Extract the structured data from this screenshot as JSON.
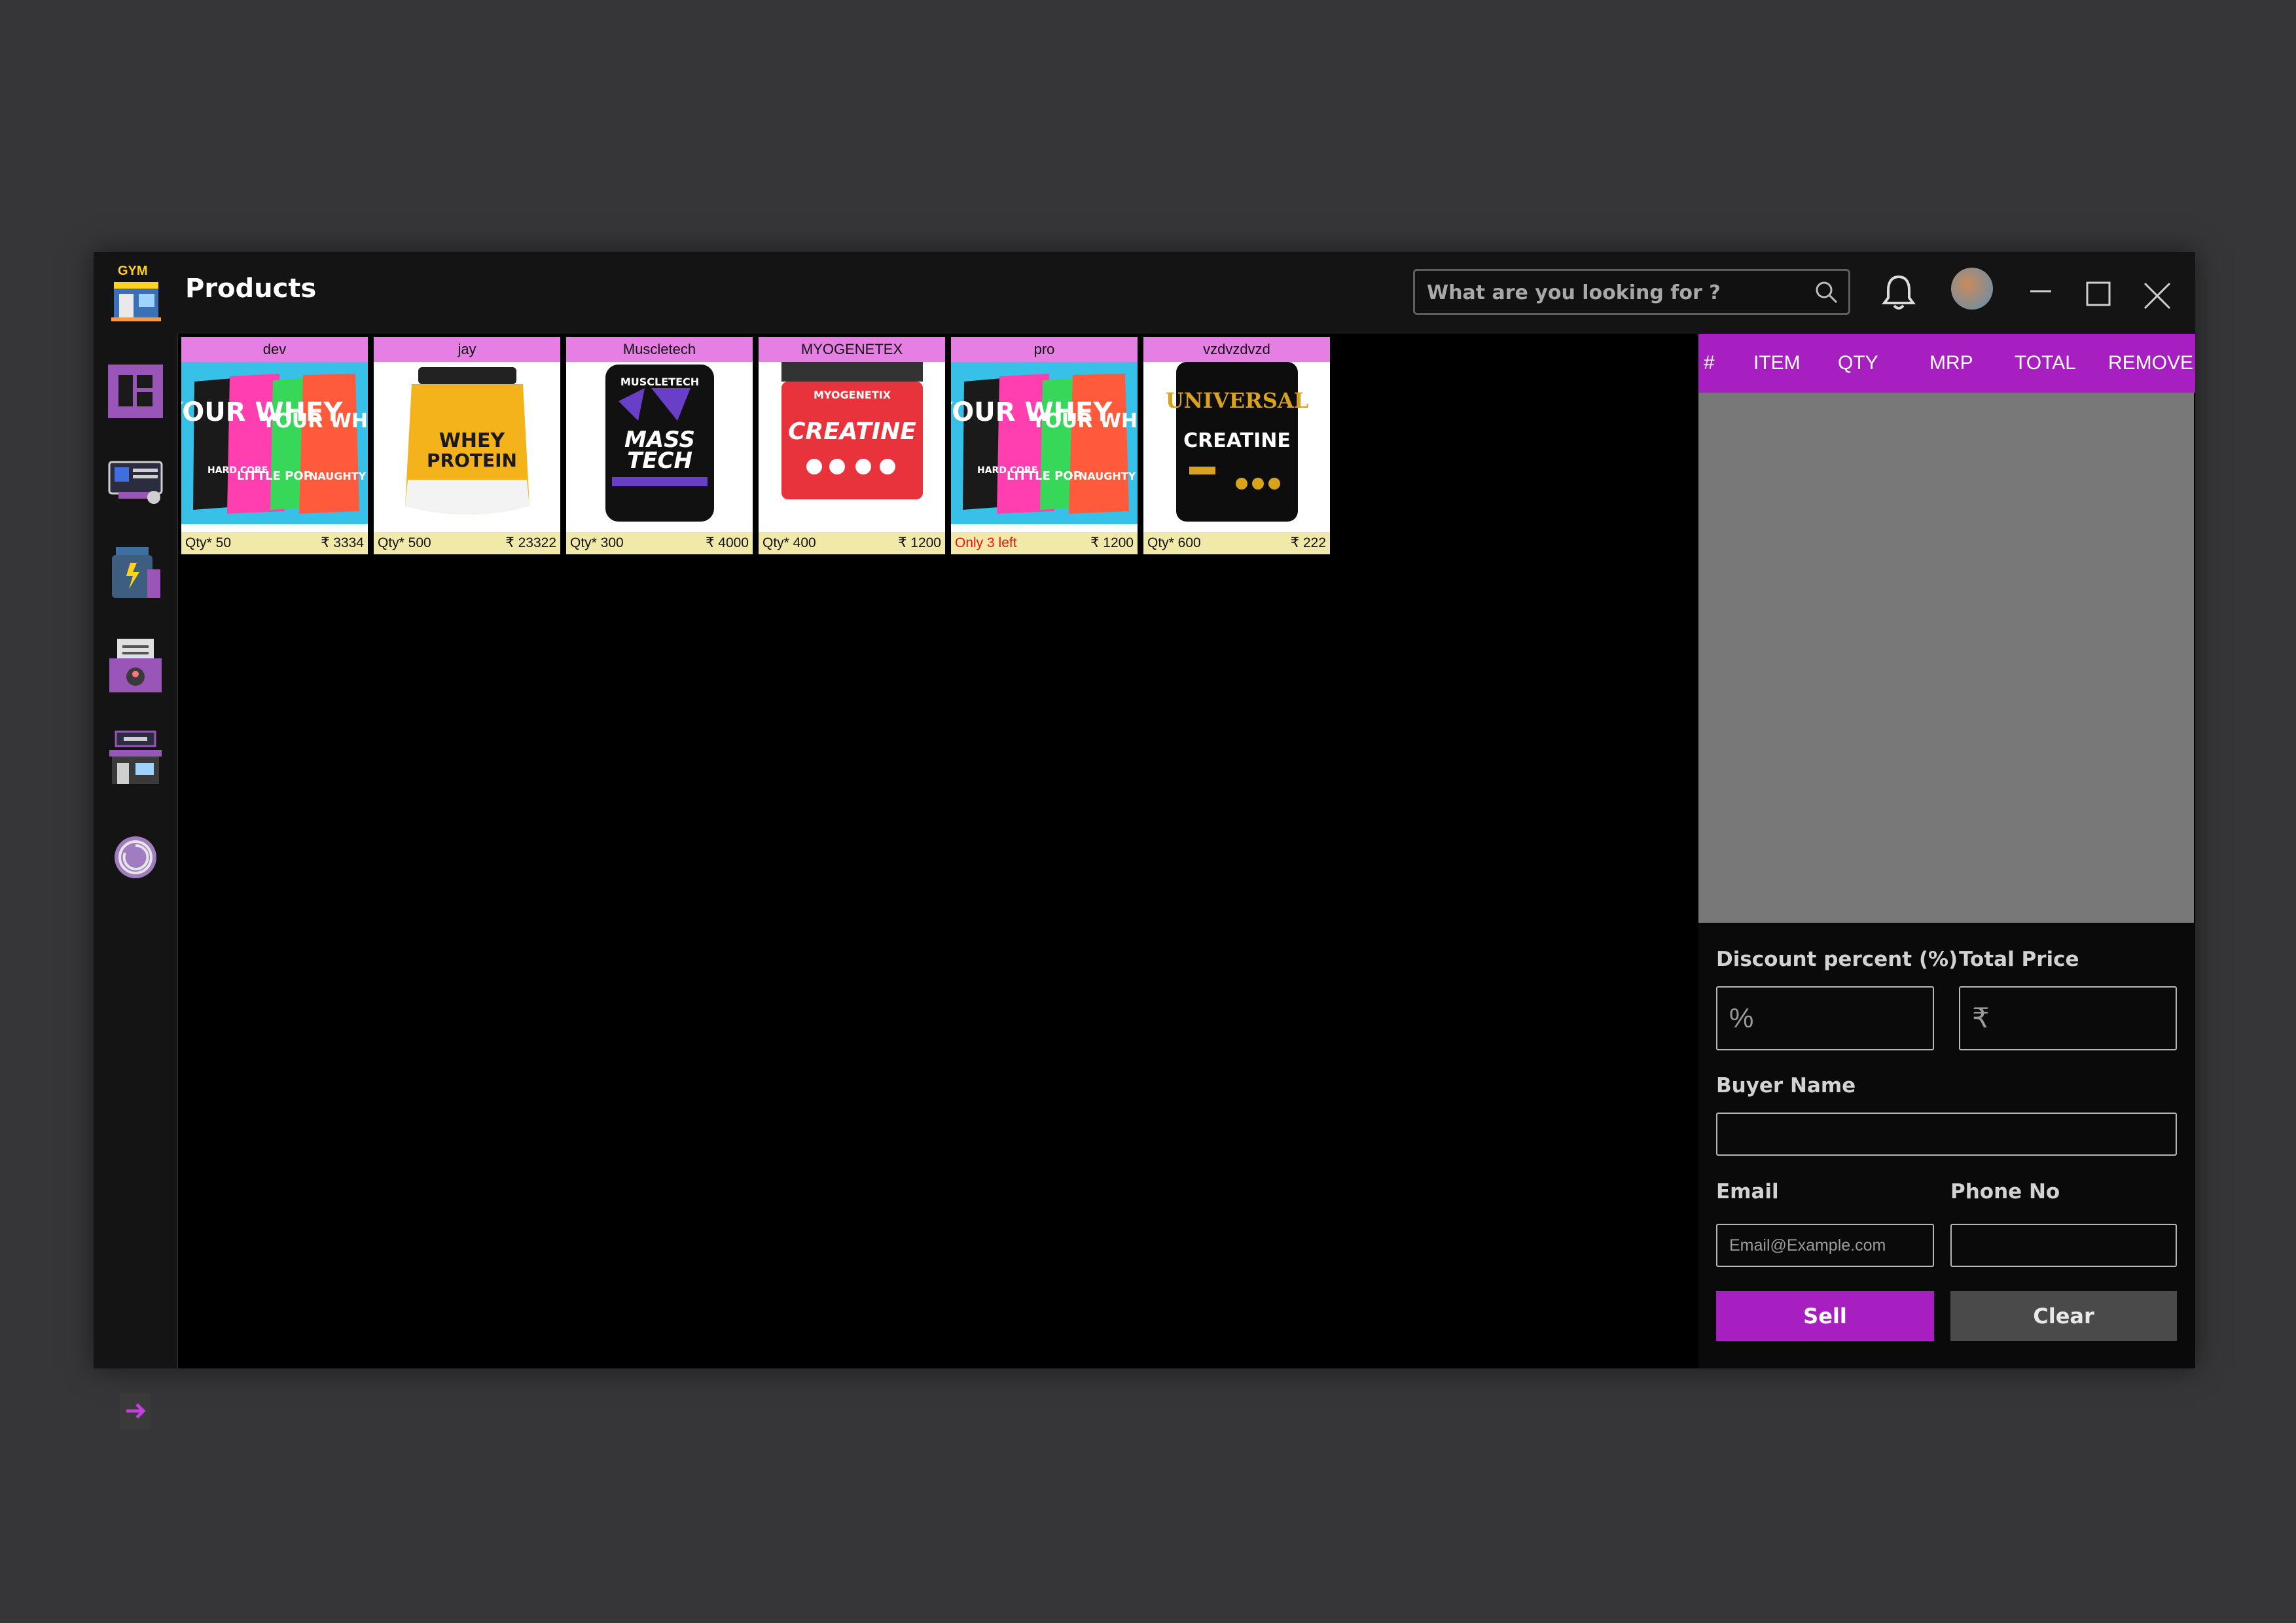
{
  "header": {
    "logo_text": "GYM",
    "title": "Products",
    "search_placeholder": "What are you looking for ?",
    "icons": [
      "bell-icon",
      "avatar",
      "minimize-icon",
      "maximize-icon",
      "close-icon"
    ]
  },
  "sidebar": {
    "items": [
      {
        "icon": "dashboard-icon"
      },
      {
        "icon": "equipment-icon"
      },
      {
        "icon": "supplement-icon"
      },
      {
        "icon": "member-report-icon"
      },
      {
        "icon": "gym-store-icon"
      },
      {
        "icon": "settings-circle-icon"
      }
    ],
    "logout_icon": "logout-arrow-icon"
  },
  "products": [
    {
      "name": "dev",
      "qty": "Qty* 50",
      "price": "₹ 3334",
      "low": false,
      "image": "pouches"
    },
    {
      "name": "jay",
      "qty": "Qty* 500",
      "price": "₹ 23322",
      "low": false,
      "image": "whey-tub"
    },
    {
      "name": "Muscletech",
      "qty": "Qty* 300",
      "price": "₹ 4000",
      "low": false,
      "image": "masstech"
    },
    {
      "name": "MYOGENETEX",
      "qty": "Qty* 400",
      "price": "₹ 1200",
      "low": false,
      "image": "creatine-red"
    },
    {
      "name": "pro",
      "qty": "Only 3 left",
      "price": "₹ 1200",
      "low": true,
      "image": "pouches"
    },
    {
      "name": "vzdvzdvzd",
      "qty": "Qty* 600",
      "price": "₹ 222",
      "low": false,
      "image": "creatine-black"
    }
  ],
  "product_images": {
    "pouches": [
      "YOUR WHEY",
      "HARD CORE",
      "LITTLE POP",
      "NAUGHTY LOOP"
    ],
    "whey-tub": [
      "WHEY",
      "PROTEIN"
    ],
    "masstech": [
      "MUSCLETECH",
      "MASS",
      "TECH"
    ],
    "creatine-red": [
      "MYOGENETIX",
      "CREATINE"
    ],
    "creatine-black": [
      "UNIVERSAL",
      "CREATINE"
    ]
  },
  "cart": {
    "columns": [
      "#",
      "ITEM",
      "QTY",
      "MRP",
      "TOTAL",
      "REMOVE"
    ],
    "rows": []
  },
  "form": {
    "discount_label": "Discount percent (%)",
    "discount_placeholder": "%",
    "total_label": "Total Price",
    "total_placeholder": "₹",
    "buyer_label": "Buyer Name",
    "buyer_value": "",
    "email_label": "Email",
    "email_placeholder": "Email@Example.com",
    "phone_label": "Phone No",
    "phone_value": "",
    "sell_label": "Sell",
    "clear_label": "Clear"
  },
  "colors": {
    "accent": "#a71fc0",
    "card_header": "#e67fe3",
    "card_footer": "#f0e9a8",
    "low_stock": "#e8111b"
  }
}
